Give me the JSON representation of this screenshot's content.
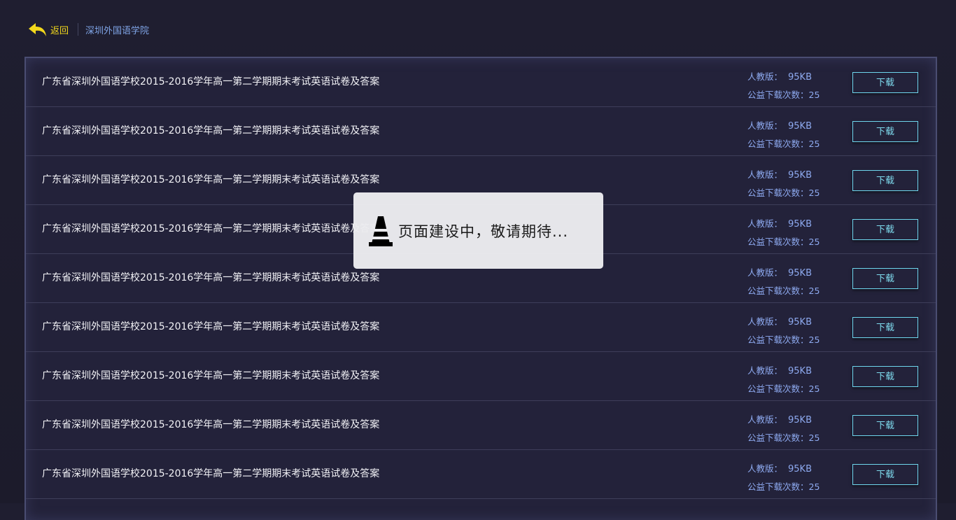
{
  "header": {
    "back_label": "返回",
    "breadcrumb": "深圳外国语学院"
  },
  "colors": {
    "accent_yellow": "#f2d81c",
    "link_blue": "#7fa4e6",
    "button_cyan": "#6fd7ee"
  },
  "list": {
    "items": [
      {
        "title": "广东省深圳外国语学校2015-2016学年高一第二学期期末考试英语试卷及答案",
        "edition_label": "人教版：",
        "size": "95KB",
        "downloads_label": "公益下载次数：",
        "downloads": "25",
        "button": "下载"
      },
      {
        "title": "广东省深圳外国语学校2015-2016学年高一第二学期期末考试英语试卷及答案",
        "edition_label": "人教版：",
        "size": "95KB",
        "downloads_label": "公益下载次数：",
        "downloads": "25",
        "button": "下载"
      },
      {
        "title": "广东省深圳外国语学校2015-2016学年高一第二学期期末考试英语试卷及答案",
        "edition_label": "人教版：",
        "size": "95KB",
        "downloads_label": "公益下载次数：",
        "downloads": "25",
        "button": "下载"
      },
      {
        "title": "广东省深圳外国语学校2015-2016学年高一第二学期期末考试英语试卷及答案",
        "edition_label": "人教版：",
        "size": "95KB",
        "downloads_label": "公益下载次数：",
        "downloads": "25",
        "button": "下载"
      },
      {
        "title": "广东省深圳外国语学校2015-2016学年高一第二学期期末考试英语试卷及答案",
        "edition_label": "人教版：",
        "size": "95KB",
        "downloads_label": "公益下载次数：",
        "downloads": "25",
        "button": "下载"
      },
      {
        "title": "广东省深圳外国语学校2015-2016学年高一第二学期期末考试英语试卷及答案",
        "edition_label": "人教版：",
        "size": "95KB",
        "downloads_label": "公益下载次数：",
        "downloads": "25",
        "button": "下载"
      },
      {
        "title": "广东省深圳外国语学校2015-2016学年高一第二学期期末考试英语试卷及答案",
        "edition_label": "人教版：",
        "size": "95KB",
        "downloads_label": "公益下载次数：",
        "downloads": "25",
        "button": "下载"
      },
      {
        "title": "广东省深圳外国语学校2015-2016学年高一第二学期期末考试英语试卷及答案",
        "edition_label": "人教版：",
        "size": "95KB",
        "downloads_label": "公益下载次数：",
        "downloads": "25",
        "button": "下载"
      },
      {
        "title": "广东省深圳外国语学校2015-2016学年高一第二学期期末考试英语试卷及答案",
        "edition_label": "人教版：",
        "size": "95KB",
        "downloads_label": "公益下载次数：",
        "downloads": "25",
        "button": "下载"
      }
    ]
  },
  "toast": {
    "icon": "traffic-cone-icon",
    "message": "页面建设中，敬请期待..."
  }
}
